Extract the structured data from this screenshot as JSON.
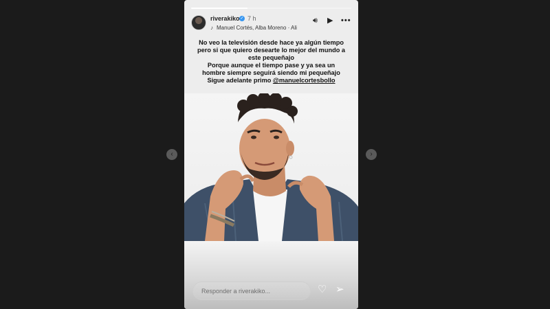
{
  "story": {
    "progress": 0.35,
    "user": {
      "username": "riverakiko",
      "verified_icon": "verified-badge-icon",
      "time": "7 h"
    },
    "music": {
      "icon": "music-note-icon",
      "text": "Manuel Cortés, Alba Moreno · Ali"
    },
    "controls": {
      "sound_icon": "speaker-icon",
      "play_icon": "play-icon",
      "more_icon": "more-icon",
      "sound": "🔊︎",
      "play": "▶",
      "more": "•••"
    },
    "caption": {
      "lines": [
        "No veo la televisión desde hace ya algún tiempo",
        "pero si que quiero desearte lo mejor del mundo a",
        "este pequeñajo",
        "Porque aunque el tiempo pase y ya sea un",
        "hombre siempre seguirá siendo mi pequeñajo"
      ],
      "last_prefix": "Sigue adelante primo ",
      "mention": "@manuelcortesbollo"
    },
    "reply": {
      "placeholder": "Responder a riverakiko..."
    },
    "actions": {
      "like_icon": "heart-icon",
      "share_icon": "send-icon",
      "like": "♡",
      "share": "➢"
    },
    "nav": {
      "prev_icon": "chevron-left-icon",
      "next_icon": "chevron-right-icon",
      "prev": "‹",
      "next": "›"
    }
  }
}
